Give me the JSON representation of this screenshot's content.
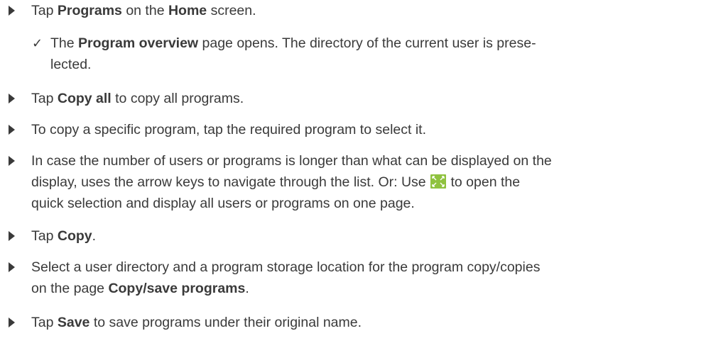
{
  "steps": [
    {
      "pre": "Tap ",
      "b1": "Programs",
      "mid": " on the ",
      "b2": "Home",
      "post": " screen."
    },
    {
      "pre": "The ",
      "b1": "Program overview",
      "line1_rest": " page opens. The directory of the current user is prese-",
      "line2": "lected."
    },
    {
      "pre": "Tap ",
      "b1": "Copy all",
      "post": " to copy all programs."
    },
    {
      "text": "To copy a specific program, tap the required program to select it."
    },
    {
      "line1": "In case the number of users or programs is longer than what can be displayed on the",
      "line2_pre": "display, uses the arrow keys to navigate through the list. Or: Use ",
      "line2_post": " to open the",
      "line3": "quick selection and display all users or programs on one page."
    },
    {
      "pre": "Tap ",
      "b1": "Copy",
      "post": "."
    },
    {
      "line1": "Select a user directory and a program storage location for the program copy/copies",
      "line2_pre": "on the page ",
      "b1": "Copy/save programs",
      "line2_post": "."
    },
    {
      "pre": "Tap ",
      "b1": "Save",
      "post": " to save programs under their original name."
    }
  ],
  "icons": {
    "bullet": "triangle-right-icon",
    "check": "checkmark-icon",
    "quick_select": "expand-arrows-icon",
    "quick_select_color": "#8fc23f"
  }
}
